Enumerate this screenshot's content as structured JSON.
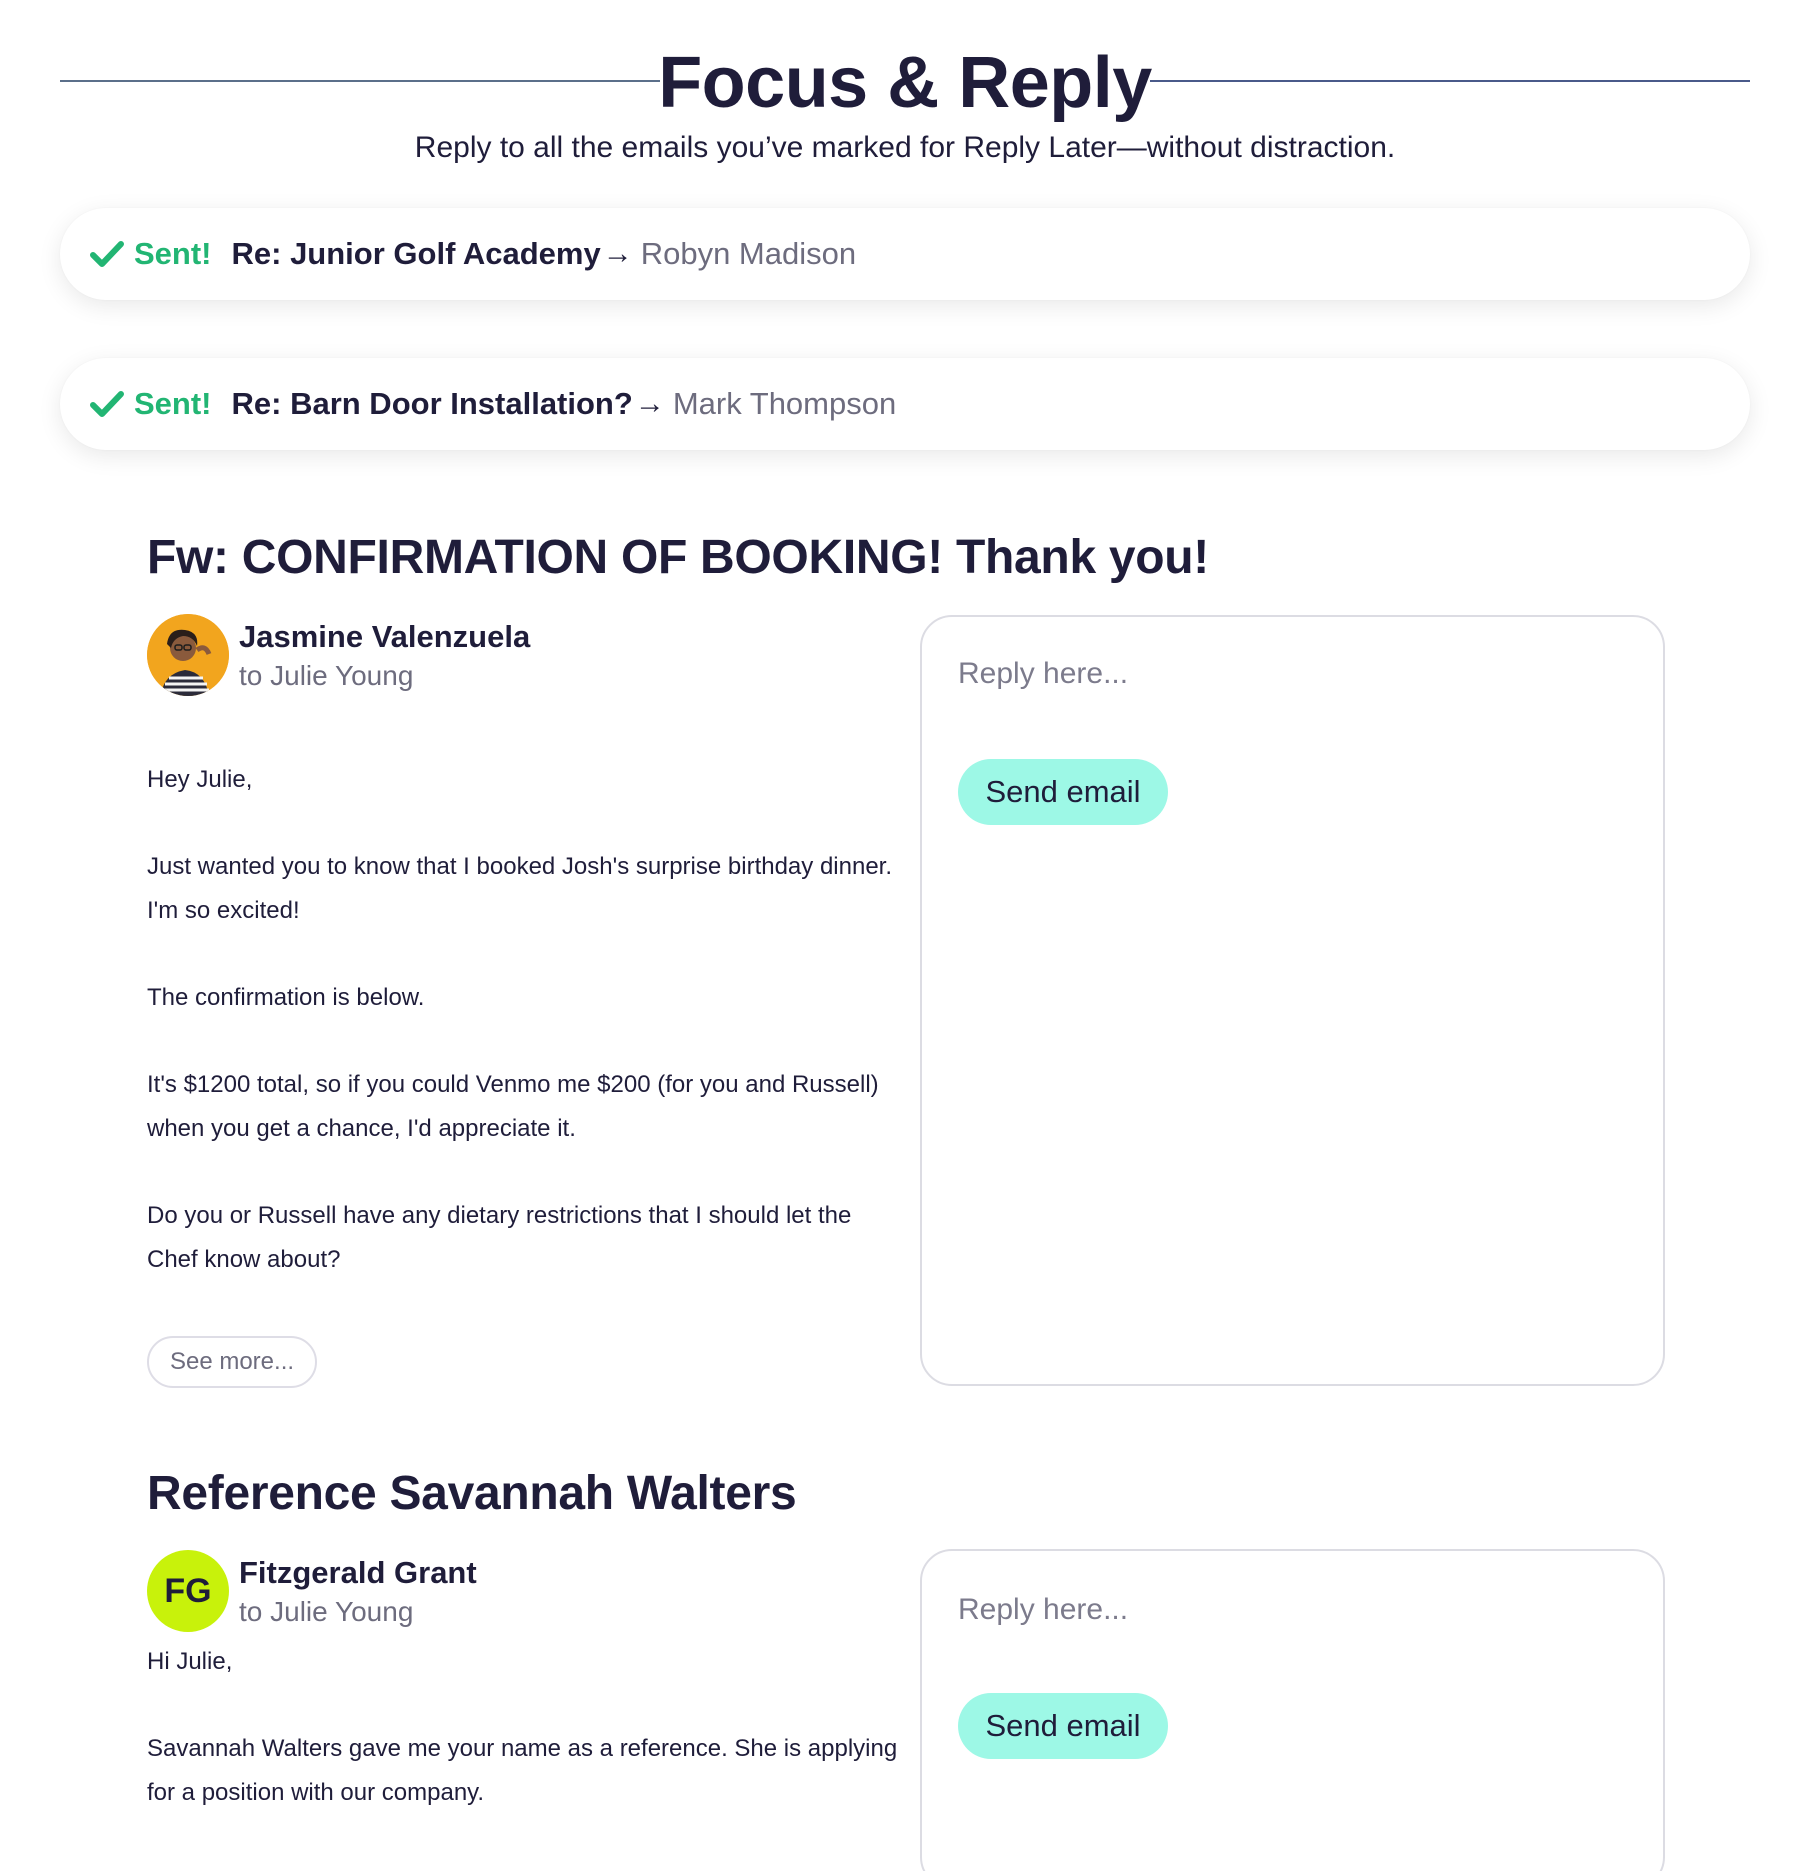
{
  "header": {
    "title": "Focus & Reply",
    "subtitle": "Reply to all the emails you’ve marked for Reply Later—without distraction."
  },
  "sent_items": [
    {
      "status": "Sent!",
      "subject": "Re: Junior Golf Academy",
      "arrow": "→",
      "recipient": "Robyn Madison"
    },
    {
      "status": "Sent!",
      "subject": "Re: Barn Door Installation?",
      "arrow": "→",
      "recipient": "Mark Thompson"
    }
  ],
  "emails": [
    {
      "subject": "Fw: CONFIRMATION OF BOOKING! Thank you!",
      "sender": "Jasmine Valenzuela",
      "to": "to Julie Young",
      "paragraphs": [
        "Hey Julie,",
        "Just wanted you to know that I booked Josh's surprise birthday dinner. I'm so excited!",
        "The confirmation is below.",
        "It's $1200 total, so if you could Venmo me $200 (for you and Russell) when you get a chance, I'd appreciate it.",
        "Do you or Russell have any dietary restrictions that I should let the Chef know about?"
      ],
      "see_more": "See more...",
      "reply_placeholder": "Reply here...",
      "send_label": "Send email"
    },
    {
      "subject": "Reference Savannah Walters",
      "sender": "Fitzgerald Grant",
      "initials": "FG",
      "to": "to Julie Young",
      "paragraphs": [
        "Hi Julie,",
        "Savannah Walters gave me your name as a reference. She is applying for a position with our company."
      ],
      "reply_placeholder": "Reply here...",
      "send_label": "Send email"
    }
  ],
  "colors": {
    "sent_green": "#22b573",
    "send_button": "#9df8e6",
    "fg_avatar": "#c8f20b",
    "photo_avatar": "#f2a51e",
    "text_dark": "#1f1d3a",
    "text_muted": "#6d6c7e"
  }
}
